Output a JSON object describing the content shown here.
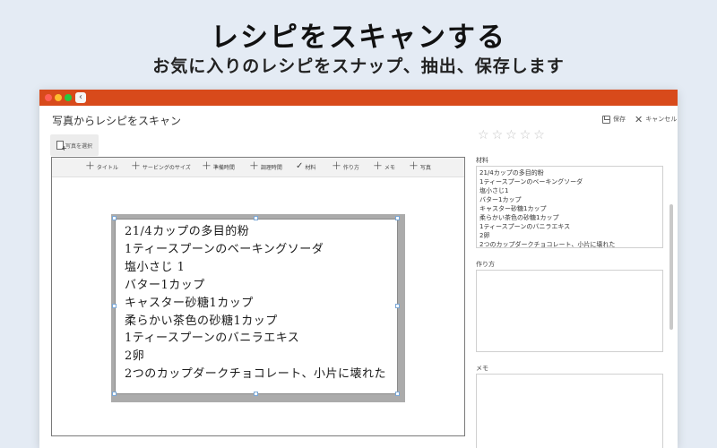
{
  "hero": {
    "title": "レシピをスキャンする",
    "subtitle": "お気に入りのレシピをスナップ、抽出、保存します"
  },
  "titlebar": {
    "back_icon": "chevron-left-icon",
    "back_glyph": "‹",
    "accent_color": "#d84a1b"
  },
  "header": {
    "title": "写真からレシピをスキャン",
    "save_label": "保存",
    "cancel_label": "キャンセル",
    "cancel_glyph": "✕"
  },
  "select_photo": {
    "label": "写真を選択"
  },
  "rating": {
    "stars_total": 5,
    "value": 0,
    "glyph": "☆"
  },
  "tag_toolbar": {
    "items": [
      {
        "label": "タイトル",
        "glyph": "+"
      },
      {
        "label": "サービングのサイズ",
        "glyph": "+"
      },
      {
        "label": "準備時間",
        "glyph": "+"
      },
      {
        "label": "調理時間",
        "glyph": "+"
      },
      {
        "label": "材料",
        "glyph": "✓"
      },
      {
        "label": "作り方",
        "glyph": "+"
      },
      {
        "label": "メモ",
        "glyph": "+"
      },
      {
        "label": "写真",
        "glyph": "+"
      }
    ]
  },
  "photo_text": [
    "21/4カップの多目的粉",
    "1ティースプーンのベーキングソーダ",
    "塩小さじ 1",
    "バター1カップ",
    "キャスター砂糖1カップ",
    "柔らかい茶色の砂糖1カップ",
    "1ティースプーンのバニラエキス",
    "2卵",
    "2つのカップダークチョコレート、小片に壊れた"
  ],
  "fields": {
    "ingredients_label": "材料",
    "ingredients": [
      "21/4カップの多目的粉",
      "1ティースプーンのベーキングソーダ",
      "塩小さじ1",
      "バター1カップ",
      "キャスター砂糖1カップ",
      "柔らかい茶色の砂糖1カップ",
      "1ティースプーンのバニラエキス",
      "2卵",
      "2つのカップダークチョコレート、小片に壊れた"
    ],
    "instructions_label": "作り方",
    "instructions_value": "",
    "notes_label": "メモ",
    "notes_value": ""
  }
}
